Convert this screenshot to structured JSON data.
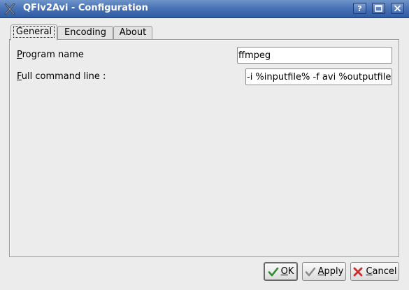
{
  "window": {
    "title": "QFlv2Avi - Configuration"
  },
  "title_buttons": {
    "help": "?",
    "maximize": "maximize",
    "close": "close"
  },
  "tabs": [
    {
      "label": "General",
      "active": true
    },
    {
      "label": "Encoding",
      "active": false
    },
    {
      "label": "About",
      "active": false
    }
  ],
  "general": {
    "program_name_label": "Program name",
    "program_name_mnemonic": "P",
    "program_name_value": "ffmpeg",
    "command_line_label": "Full command line :",
    "command_line_mnemonic": "F",
    "command_line_value": "-i %inputfile% -f avi %outputfile%"
  },
  "buttons": {
    "ok": "OK",
    "apply": "Apply",
    "cancel": "Cancel"
  },
  "colors": {
    "titlebar": "#4a74b8",
    "ok_check": "#2e8b2e",
    "cancel_x": "#cc2a2a"
  }
}
